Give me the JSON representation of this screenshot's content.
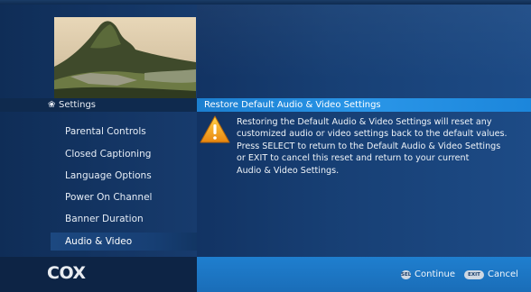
{
  "section": {
    "icon": "wrench-icon",
    "title": "Settings"
  },
  "menu": {
    "items": [
      {
        "label": "Parental Controls"
      },
      {
        "label": "Closed Captioning"
      },
      {
        "label": "Language Options"
      },
      {
        "label": "Power On Channel"
      },
      {
        "label": "Banner Duration"
      },
      {
        "label": "Audio & Video"
      }
    ],
    "selected": "Audio & Video"
  },
  "dialog": {
    "title": "Restore Default Audio & Video Settings",
    "icon": "warning-icon",
    "message": "Restoring the Default Audio & Video Settings will reset any\ncustomized audio or video settings back to the default values.\nPress SELECT to return to the Default Audio & Video Settings\nor EXIT to cancel this reset and return to your current\nAudio & Video Settings."
  },
  "footer": {
    "logo": "COX",
    "continue": {
      "key": "SEL",
      "label": "Continue"
    },
    "cancel": {
      "key": "EXIT",
      "label": "Cancel"
    }
  },
  "colors": {
    "background": "#153f72",
    "dialog_header": "#2a96e8",
    "footer_right": "#1f7fcf",
    "warning": "#f3a21c"
  }
}
